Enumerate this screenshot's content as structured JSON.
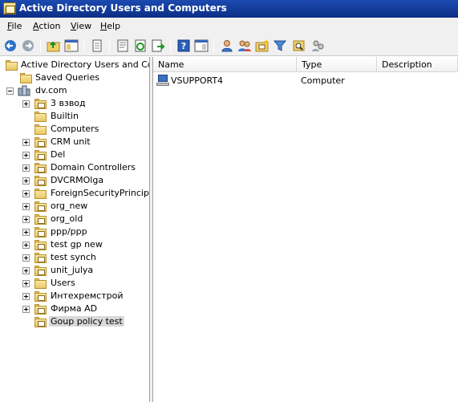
{
  "window": {
    "title": "Active Directory Users and Computers"
  },
  "menu": [
    {
      "accel": "F",
      "rest": "ile"
    },
    {
      "accel": "A",
      "rest": "ction"
    },
    {
      "accel": "V",
      "rest": "iew"
    },
    {
      "accel": "H",
      "rest": "elp"
    }
  ],
  "toolbar": {
    "icons": [
      "back-icon",
      "forward-icon",
      "up-folder-icon",
      "show-hide-tree-icon",
      "copy-icon",
      "properties-icon",
      "refresh-icon",
      "export-icon",
      "help-icon",
      "show-action-pane-icon",
      "new-user-icon",
      "new-group-icon",
      "new-ou-icon",
      "filter-icon",
      "find-icon",
      "add-to-group-icon"
    ]
  },
  "tree": {
    "root": "Active Directory Users and Comp",
    "saved_queries": "Saved Queries",
    "domain": "dv.com",
    "children": [
      {
        "label": "3 взвод",
        "expandable": true,
        "ou": true
      },
      {
        "label": "Builtin",
        "expandable": false,
        "ou": false
      },
      {
        "label": "Computers",
        "expandable": false,
        "ou": false
      },
      {
        "label": "CRM unit",
        "expandable": true,
        "ou": true
      },
      {
        "label": "Del",
        "expandable": true,
        "ou": true
      },
      {
        "label": "Domain Controllers",
        "expandable": true,
        "ou": true
      },
      {
        "label": "DVCRMOlga",
        "expandable": true,
        "ou": true
      },
      {
        "label": "ForeignSecurityPrincipals",
        "expandable": true,
        "ou": false
      },
      {
        "label": "org_new",
        "expandable": true,
        "ou": true
      },
      {
        "label": "org_old",
        "expandable": true,
        "ou": true
      },
      {
        "label": "ppp/ppp",
        "expandable": true,
        "ou": true
      },
      {
        "label": "test gp new",
        "expandable": true,
        "ou": true
      },
      {
        "label": "test synch",
        "expandable": true,
        "ou": true
      },
      {
        "label": "unit_julya",
        "expandable": true,
        "ou": true
      },
      {
        "label": "Users",
        "expandable": true,
        "ou": false
      },
      {
        "label": "Интехремстрой",
        "expandable": true,
        "ou": true
      },
      {
        "label": "Фирма AD",
        "expandable": true,
        "ou": true
      },
      {
        "label": "Goup policy test",
        "expandable": false,
        "ou": true,
        "selected": true
      }
    ]
  },
  "list": {
    "columns": [
      "Name",
      "Type",
      "Description"
    ],
    "rows": [
      {
        "name": "VSUPPORT4",
        "type": "Computer",
        "description": ""
      }
    ]
  }
}
